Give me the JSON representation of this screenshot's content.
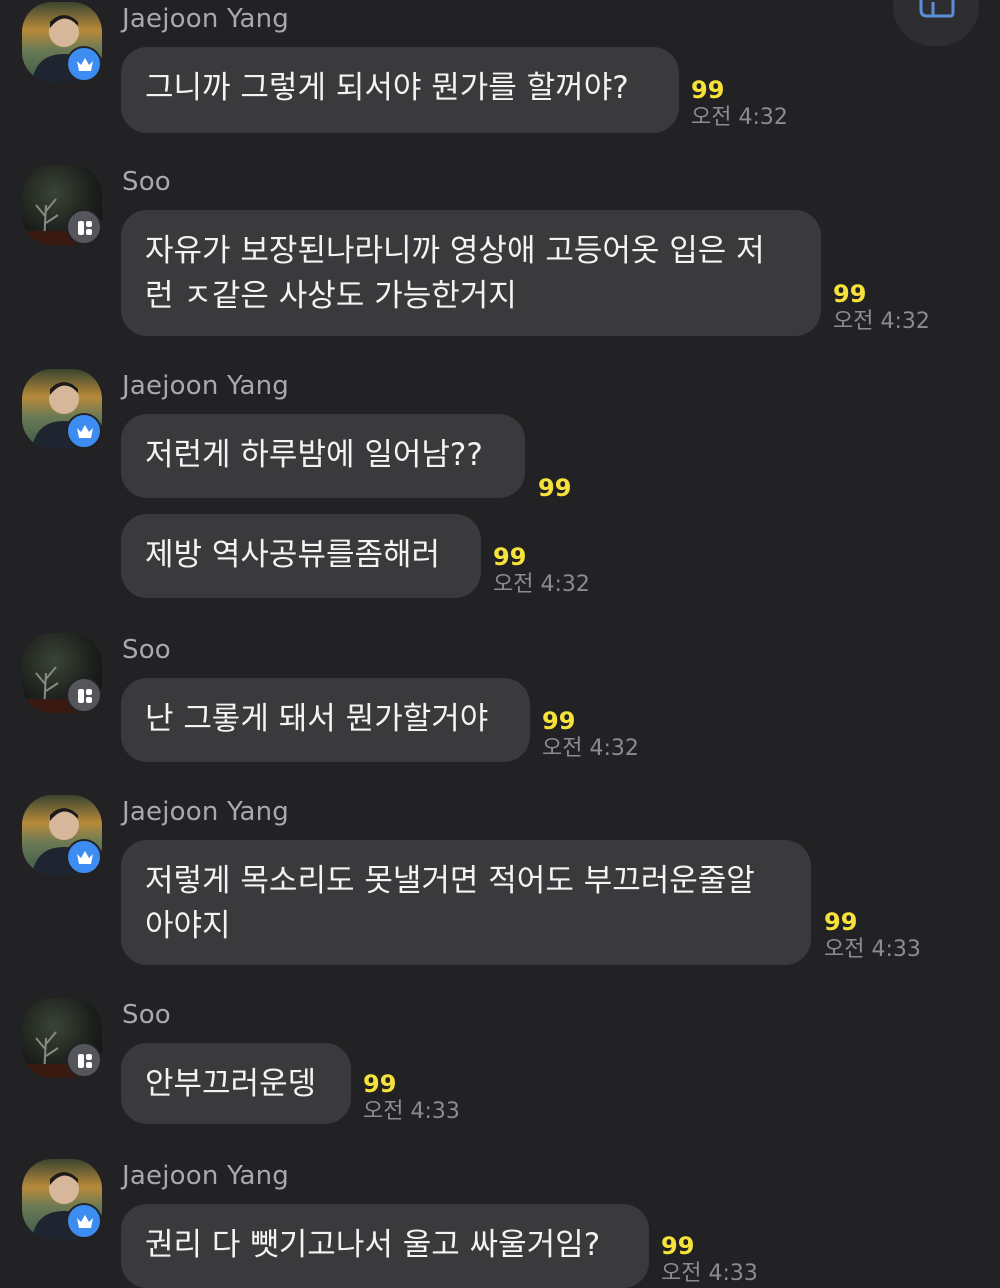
{
  "header": {
    "icon": "megaphone-icon"
  },
  "messages": [
    {
      "sender": "Jaejoon Yang",
      "badge": "crown-icon",
      "bubbles": [
        {
          "text": "그니까 그렇게 되서야 뭔가를 할꺼야?",
          "read": "99",
          "time": "오전 4:32"
        }
      ]
    },
    {
      "sender": "Soo",
      "badge": "app-grid-icon",
      "bubbles": [
        {
          "text": "자유가 보장된나라니까 영상애 고등어옷 입은 저\n런 ㅈ같은 사상도 가능한거지",
          "read": "99",
          "time": "오전 4:32"
        }
      ]
    },
    {
      "sender": "Jaejoon Yang",
      "badge": "crown-icon",
      "bubbles": [
        {
          "text": "저런게 하루밤에 일어남??",
          "read": "99",
          "time": ""
        },
        {
          "text": "제방 역사공뷰를좀해러",
          "read": "99",
          "time": "오전 4:32"
        }
      ]
    },
    {
      "sender": "Soo",
      "badge": "app-grid-icon",
      "bubbles": [
        {
          "text": "난 그롷게 돼서 뭔가할거야",
          "read": "99",
          "time": "오전 4:32"
        }
      ]
    },
    {
      "sender": "Jaejoon Yang",
      "badge": "crown-icon",
      "bubbles": [
        {
          "text": "저렇게 목소리도 못낼거면 적어도 부끄러운줄알\n아야지",
          "read": "99",
          "time": "오전 4:33"
        }
      ]
    },
    {
      "sender": "Soo",
      "badge": "app-grid-icon",
      "bubbles": [
        {
          "text": "안부끄러운뎅",
          "read": "99",
          "time": "오전 4:33"
        }
      ]
    },
    {
      "sender": "Jaejoon Yang",
      "badge": "crown-icon",
      "bubbles": [
        {
          "text": "권리 다 뺏기고나서 울고 싸울거임?",
          "read": "99",
          "time": "오전 4:33"
        }
      ]
    }
  ],
  "colors": {
    "background": "#222224",
    "bubble": "#3a3a3d",
    "read_count": "#f6e23a",
    "crown_badge": "#3d8cf2"
  }
}
